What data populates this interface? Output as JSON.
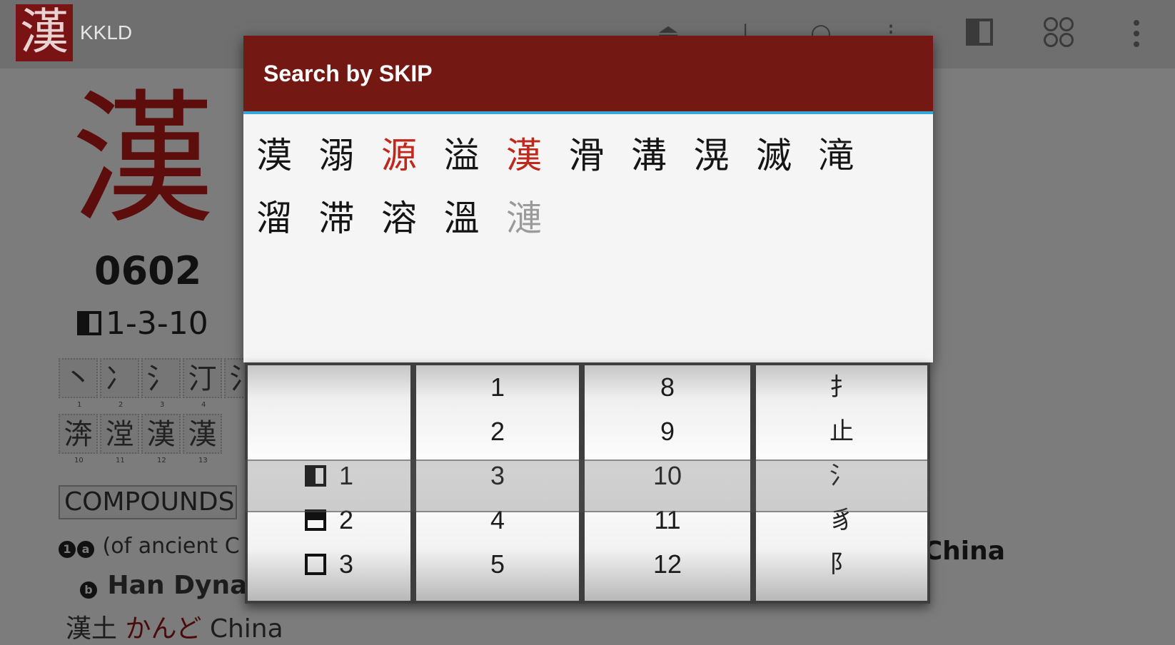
{
  "app": {
    "logo_char": "漢",
    "title": "KKLD"
  },
  "actionbar": {
    "icons": [
      "stroke-up-icon",
      "radical-icon",
      "circle-search-icon",
      "stroke-order-icon",
      "skip-panel-icon",
      "grid-icon",
      "overflow-menu-icon"
    ],
    "icon_glyphs": [
      "⏏",
      "⊥",
      "○",
      "⁝"
    ]
  },
  "entry": {
    "kanji": "漢",
    "number": "0602",
    "skip_code": "1-3-10",
    "strokes_row1": [
      "丶",
      "冫",
      "氵",
      "汀",
      "氵"
    ],
    "stroke_nums_row1": [
      "1",
      "2",
      "3",
      "4"
    ],
    "strokes_row2": [
      "渀",
      "漟",
      "漢",
      "漢"
    ],
    "stroke_nums_row2": [
      "10",
      "11",
      "12",
      "13"
    ],
    "compounds_label": "COMPOUNDS",
    "bullet1": "1",
    "bullet_a": "a",
    "bullet_b": "b",
    "def1": "(of ancient C",
    "def1_right": "t China",
    "def2": "Han Dynas",
    "def3_kanji": "漢土",
    "def3_reading": "かんど",
    "def3_meaning": "China"
  },
  "dialog": {
    "title": "Search by SKIP",
    "results": [
      {
        "char": "漠",
        "style": "normal"
      },
      {
        "char": "溺",
        "style": "normal"
      },
      {
        "char": "源",
        "style": "red"
      },
      {
        "char": "溢",
        "style": "normal"
      },
      {
        "char": "漢",
        "style": "red"
      },
      {
        "char": "滑",
        "style": "normal"
      },
      {
        "char": "溝",
        "style": "normal"
      },
      {
        "char": "滉",
        "style": "normal"
      },
      {
        "char": "滅",
        "style": "normal"
      },
      {
        "char": "滝",
        "style": "normal"
      },
      {
        "char": "溜",
        "style": "normal"
      },
      {
        "char": "滞",
        "style": "normal"
      },
      {
        "char": "溶",
        "style": "normal"
      },
      {
        "char": "溫",
        "style": "normal"
      },
      {
        "char": "漣",
        "style": "faded"
      }
    ]
  },
  "picker": {
    "pattern_wheel": [
      {
        "label": "",
        "glyph": ""
      },
      {
        "label": "",
        "glyph": ""
      },
      {
        "label": "1",
        "glyph": "left"
      },
      {
        "label": "2",
        "glyph": "top"
      },
      {
        "label": "3",
        "glyph": "box"
      }
    ],
    "first_count_wheel": [
      "1",
      "2",
      "3",
      "4",
      "5"
    ],
    "second_count_wheel": [
      "8",
      "9",
      "10",
      "11",
      "12"
    ],
    "radical_wheel": [
      "扌",
      "止",
      "氵",
      "豸",
      "阝"
    ],
    "selected": {
      "pattern": "1",
      "first": "3",
      "second": "10",
      "radical": "氵"
    }
  }
}
